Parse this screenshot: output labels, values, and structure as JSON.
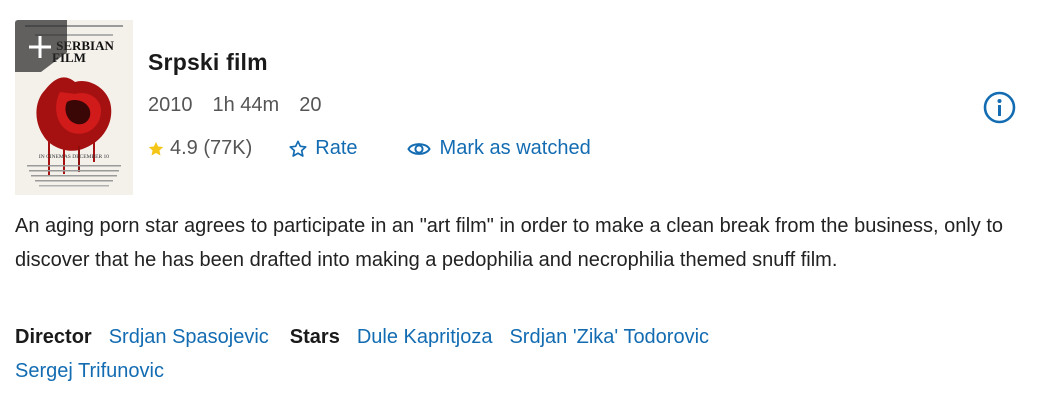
{
  "poster": {
    "title_line1": "SERBIAN",
    "title_line2": "FILM",
    "tagline": "IN CINEMAS DECEMBER 10"
  },
  "add_button": {
    "icon": "plus-icon"
  },
  "movie": {
    "title": "Srpski film",
    "year": "2010",
    "runtime": "1h 44m",
    "certificate": "20"
  },
  "rating": {
    "value": "4.9",
    "count": "(77K)",
    "icon": "star-icon",
    "star_color": "#f5c518"
  },
  "actions": {
    "rate_label": "Rate",
    "watched_label": "Mark as watched",
    "link_color": "#136cb2"
  },
  "plot": "An aging porn star agrees to participate in an \"art film\" in order to make a clean break from the business, only to discover that he has been drafted into making a pedophilia and necrophilia themed snuff film.",
  "credits": {
    "director_label": "Director",
    "director": "Srdjan Spasojevic",
    "stars_label": "Stars",
    "stars": [
      "Dule Kapritjoza",
      "Srdjan 'Zika' Todorovic",
      "Sergej Trifunovic"
    ]
  }
}
